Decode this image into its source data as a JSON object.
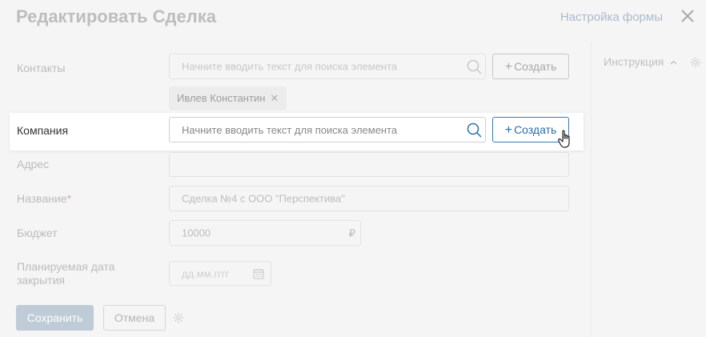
{
  "header": {
    "title": "Редактировать Сделка",
    "form_settings_label": "Настройка формы"
  },
  "fields": {
    "contacts": {
      "label": "Контакты",
      "placeholder": "Начните вводить текст для поиска элемента",
      "create_label": "Создать",
      "chip_label": "Ивлев Константин"
    },
    "company": {
      "label": "Компания",
      "placeholder": "Начните вводить текст для поиска элемента",
      "create_label": "Создать"
    },
    "address": {
      "label": "Адрес",
      "value": ""
    },
    "name": {
      "label": "Название",
      "required_mark": "*",
      "value": "Сделка №4 с ООО \"Перспектива\""
    },
    "budget": {
      "label": "Бюджет",
      "value": "10000",
      "currency": "₽"
    },
    "close_date": {
      "label_line1": "Планируемая дата",
      "label_line2": "закрытия",
      "placeholder": "дд.мм.гггг"
    }
  },
  "footer": {
    "save_label": "Сохранить",
    "cancel_label": "Отмена"
  },
  "side": {
    "instruction_label": "Инструкция"
  },
  "colors": {
    "accent": "#2d6ea6",
    "background": "#f5f5f5",
    "highlight_row": "#ffffff",
    "save_button": "#bfcbd6",
    "required": "#e8a3a3"
  },
  "icons": [
    "close-icon",
    "search-icon",
    "chip-remove-icon",
    "calendar-icon",
    "gear-icon",
    "chevron-up-icon",
    "hand-cursor-icon"
  ]
}
